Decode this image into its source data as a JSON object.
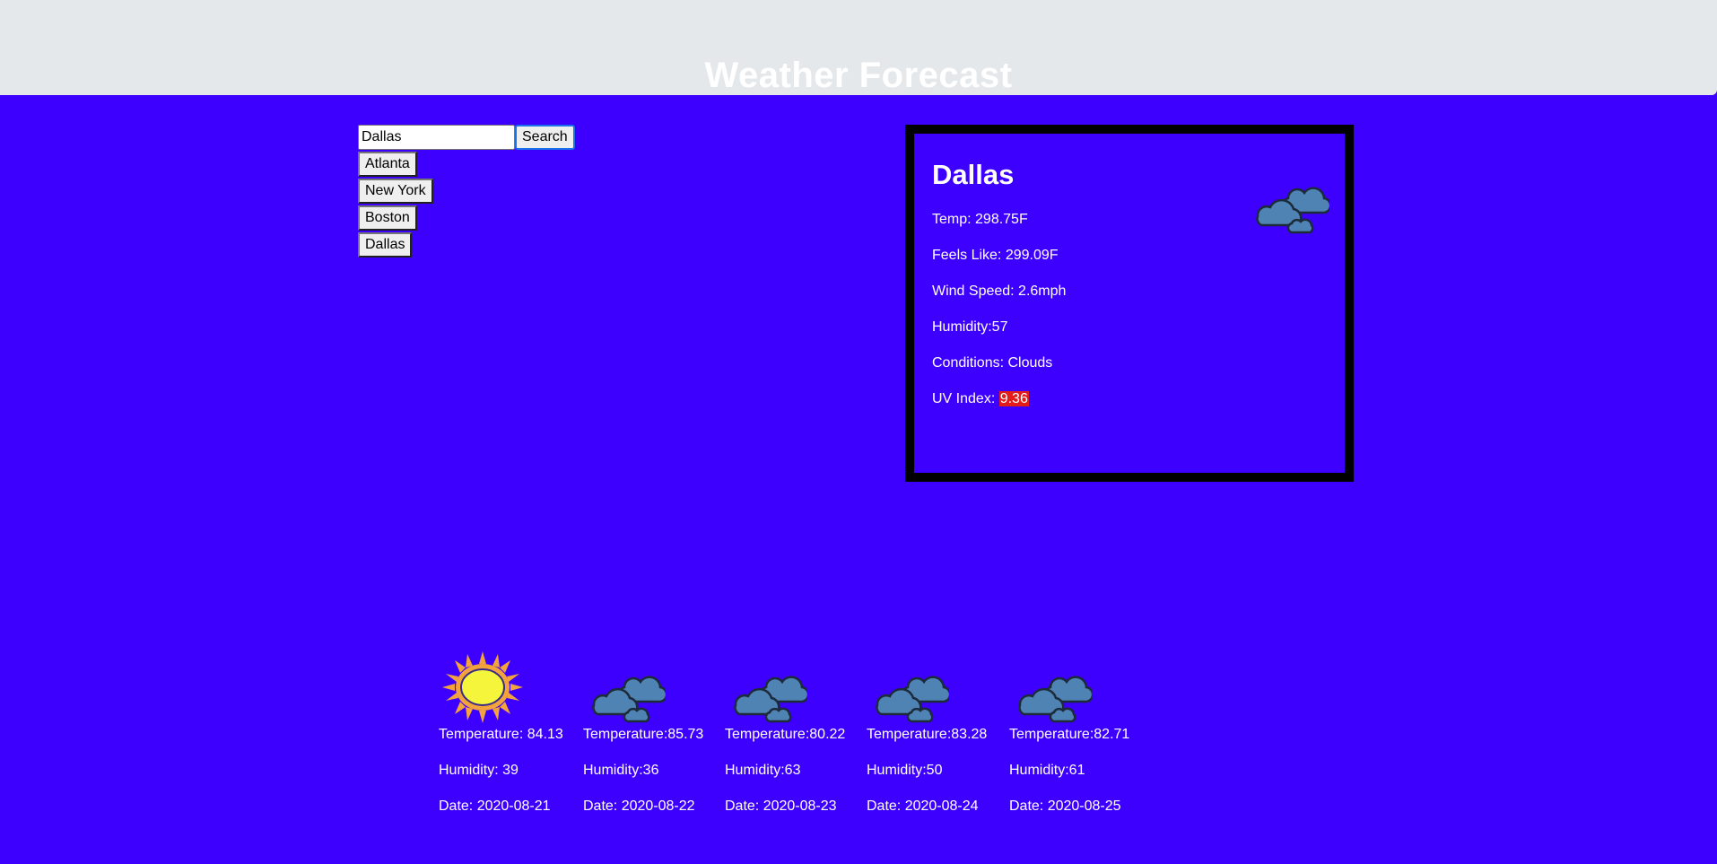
{
  "header": {
    "title": "Weather Forecast"
  },
  "search": {
    "value": "Dallas",
    "button_label": "Search"
  },
  "history": [
    "Atlanta",
    "New York",
    "Boston",
    "Dallas"
  ],
  "current": {
    "city": "Dallas",
    "icon": "clouds-icon",
    "temp": "Temp: 298.75F",
    "feels_like": "Feels Like: 299.09F",
    "wind": "Wind Speed: 2.6mph",
    "humidity": "Humidity:57",
    "conditions": "Conditions: Clouds",
    "uv_label": "UV Index: ",
    "uv_value": "9.36",
    "uv_color": "#e21b1b"
  },
  "forecast": [
    {
      "icon": "sun-icon",
      "temp": "Temperature: 84.13",
      "humidity": "Humidity: 39",
      "date": "Date: 2020-08-21"
    },
    {
      "icon": "clouds-icon",
      "temp": "Temperature:85.73",
      "humidity": "Humidity:36",
      "date": "Date: 2020-08-22"
    },
    {
      "icon": "clouds-icon",
      "temp": "Temperature:80.22",
      "humidity": "Humidity:63",
      "date": "Date: 2020-08-23"
    },
    {
      "icon": "clouds-icon",
      "temp": "Temperature:83.28",
      "humidity": "Humidity:50",
      "date": "Date: 2020-08-24"
    },
    {
      "icon": "clouds-icon",
      "temp": "Temperature:82.71",
      "humidity": "Humidity:61",
      "date": "Date: 2020-08-25"
    }
  ],
  "colors": {
    "background": "#3d00ff",
    "header": "#e4e8eb",
    "uv_high": "#e21b1b"
  }
}
